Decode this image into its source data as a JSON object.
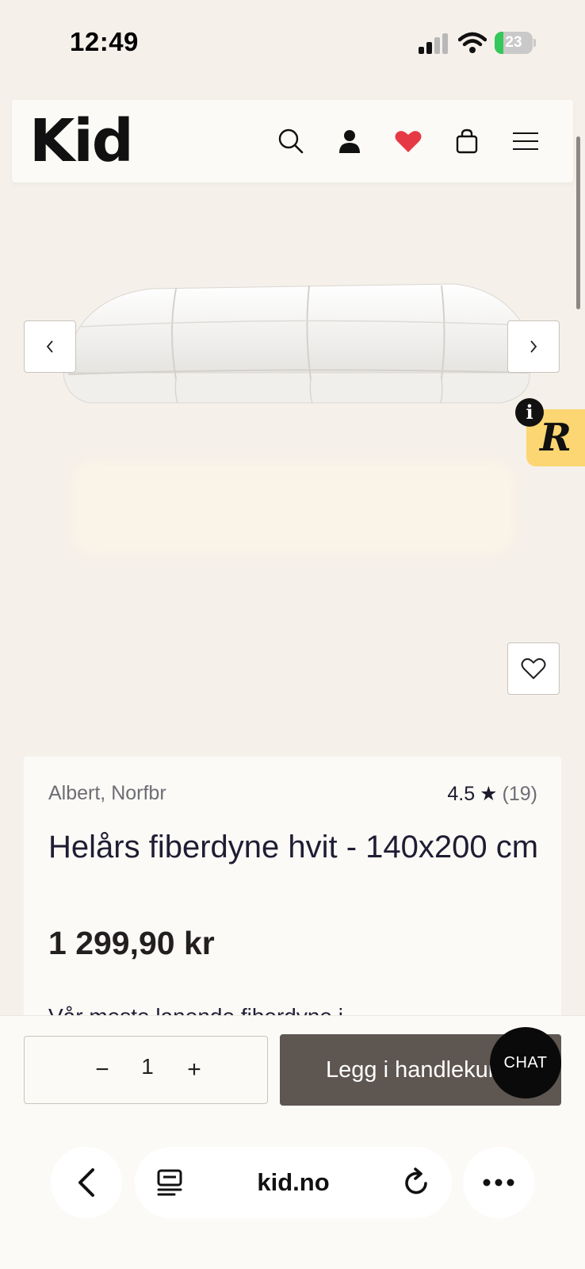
{
  "status_bar": {
    "time": "12:49",
    "battery_level": "23",
    "battery_fraction": 0.23,
    "battery_color": "#34c759"
  },
  "header": {
    "logo": "Kid",
    "icons": [
      "search-icon",
      "account-icon",
      "heart-icon",
      "bag-icon",
      "menu-icon"
    ],
    "heart_color": "#e63946"
  },
  "gallery": {
    "prev_icon": "chevron-left-icon",
    "next_icon": "chevron-right-icon",
    "favorite_icon": "heart-outline-icon",
    "widget_letter": "R",
    "widget_info": "i",
    "widget_color": "#fcd672"
  },
  "product": {
    "brand": "Albert, Norfbr",
    "rating": "4.5",
    "rating_star": "★",
    "review_count": "(19)",
    "title": "Helårs fiberdyne hvit - 140x200 cm",
    "price": "1 299,90 kr",
    "teaser": "Vår meste lanende fiberdyne i"
  },
  "buy_bar": {
    "qty_minus": "−",
    "quantity": "1",
    "qty_plus": "+",
    "add_to_cart": "Legg i handlekurv",
    "chat": "CHAT",
    "button_color": "#5e5650"
  },
  "browser": {
    "url": "kid.no",
    "icons": [
      "back-icon",
      "tabs-icon",
      "reload-icon",
      "more-icon"
    ]
  }
}
